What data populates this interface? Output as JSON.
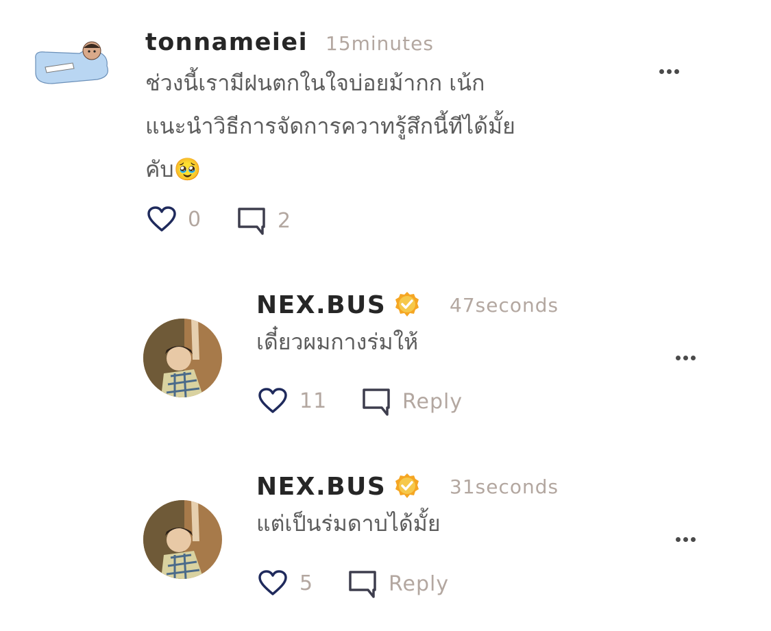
{
  "comment": {
    "username": "tonnameiei",
    "time": "15minutes",
    "text_lines": [
      "ช่วงนี้เรามีฝนตกในใจบ่อยม้ากก เน้ก",
      "แนะนำวิธีการจัดการควาทรู้สึกนี้ทีได้มั้ย",
      "คับ"
    ],
    "emoji": "🥹",
    "likes": "0",
    "replies_count": "2"
  },
  "replies": [
    {
      "username": "NEX.BUS",
      "time": "47seconds",
      "text": "เดี๋ยวผมกางร่มให้",
      "likes": "11",
      "reply_label": "Reply"
    },
    {
      "username": "NEX.BUS",
      "time": "31seconds",
      "text": "แต่เป็นร่มดาบได้มั้ย",
      "likes": "5",
      "reply_label": "Reply"
    }
  ],
  "icons": {
    "like": "heart-outline-icon",
    "reply": "speech-bubble-icon",
    "more": "more-horizontal-icon",
    "verified": "verified-badge-icon"
  },
  "colors": {
    "heart": "#1f2a5c",
    "muted": "#b3a7a0",
    "verified": "#f5a623"
  }
}
